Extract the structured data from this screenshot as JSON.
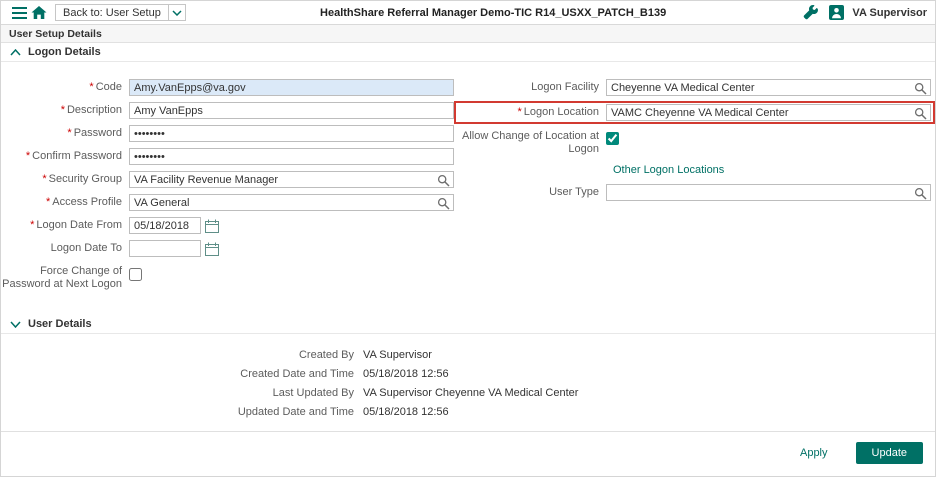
{
  "marks": {
    "required": "*"
  },
  "header": {
    "back_button_label": "Back to: User Setup",
    "app_title": "HealthShare Referral Manager Demo-TIC R14_USXX_PATCH_B139",
    "user_name": "VA Supervisor"
  },
  "page_title": "User Setup Details",
  "logon": {
    "section_title": "Logon Details",
    "code": {
      "label": "Code",
      "value": "Amy.VanEpps@va.gov"
    },
    "description": {
      "label": "Description",
      "value": "Amy VanEpps"
    },
    "password": {
      "label": "Password",
      "value": "••••••••"
    },
    "confirm_password": {
      "label": "Confirm Password",
      "value": "••••••••"
    },
    "security_group": {
      "label": "Security Group",
      "value": "VA Facility Revenue Manager"
    },
    "access_profile": {
      "label": "Access Profile",
      "value": "VA General"
    },
    "logon_date_from": {
      "label": "Logon Date From",
      "value": "05/18/2018"
    },
    "logon_date_to": {
      "label": "Logon Date To",
      "value": ""
    },
    "force_change": {
      "label": "Force Change of Password at Next Logon"
    },
    "logon_facility": {
      "label": "Logon Facility",
      "value": "Cheyenne VA Medical Center"
    },
    "logon_location": {
      "label": "Logon Location",
      "value": "VAMC Cheyenne VA Medical Center"
    },
    "allow_change": {
      "label": "Allow Change of Location at Logon",
      "checked": "checked"
    },
    "other_locations_link": "Other Logon Locations",
    "user_type": {
      "label": "User Type",
      "value": ""
    }
  },
  "user_details": {
    "section_title": "User Details",
    "rows": [
      {
        "label": "Created By",
        "value": "VA Supervisor"
      },
      {
        "label": "Created Date and Time",
        "value": "05/18/2018  12:56"
      },
      {
        "label": "Last Updated By",
        "value": "VA Supervisor  Cheyenne VA Medical Center"
      },
      {
        "label": "Updated Date and Time",
        "value": "05/18/2018  12:56"
      }
    ]
  },
  "footer": {
    "apply_label": "Apply",
    "update_label": "Update"
  }
}
